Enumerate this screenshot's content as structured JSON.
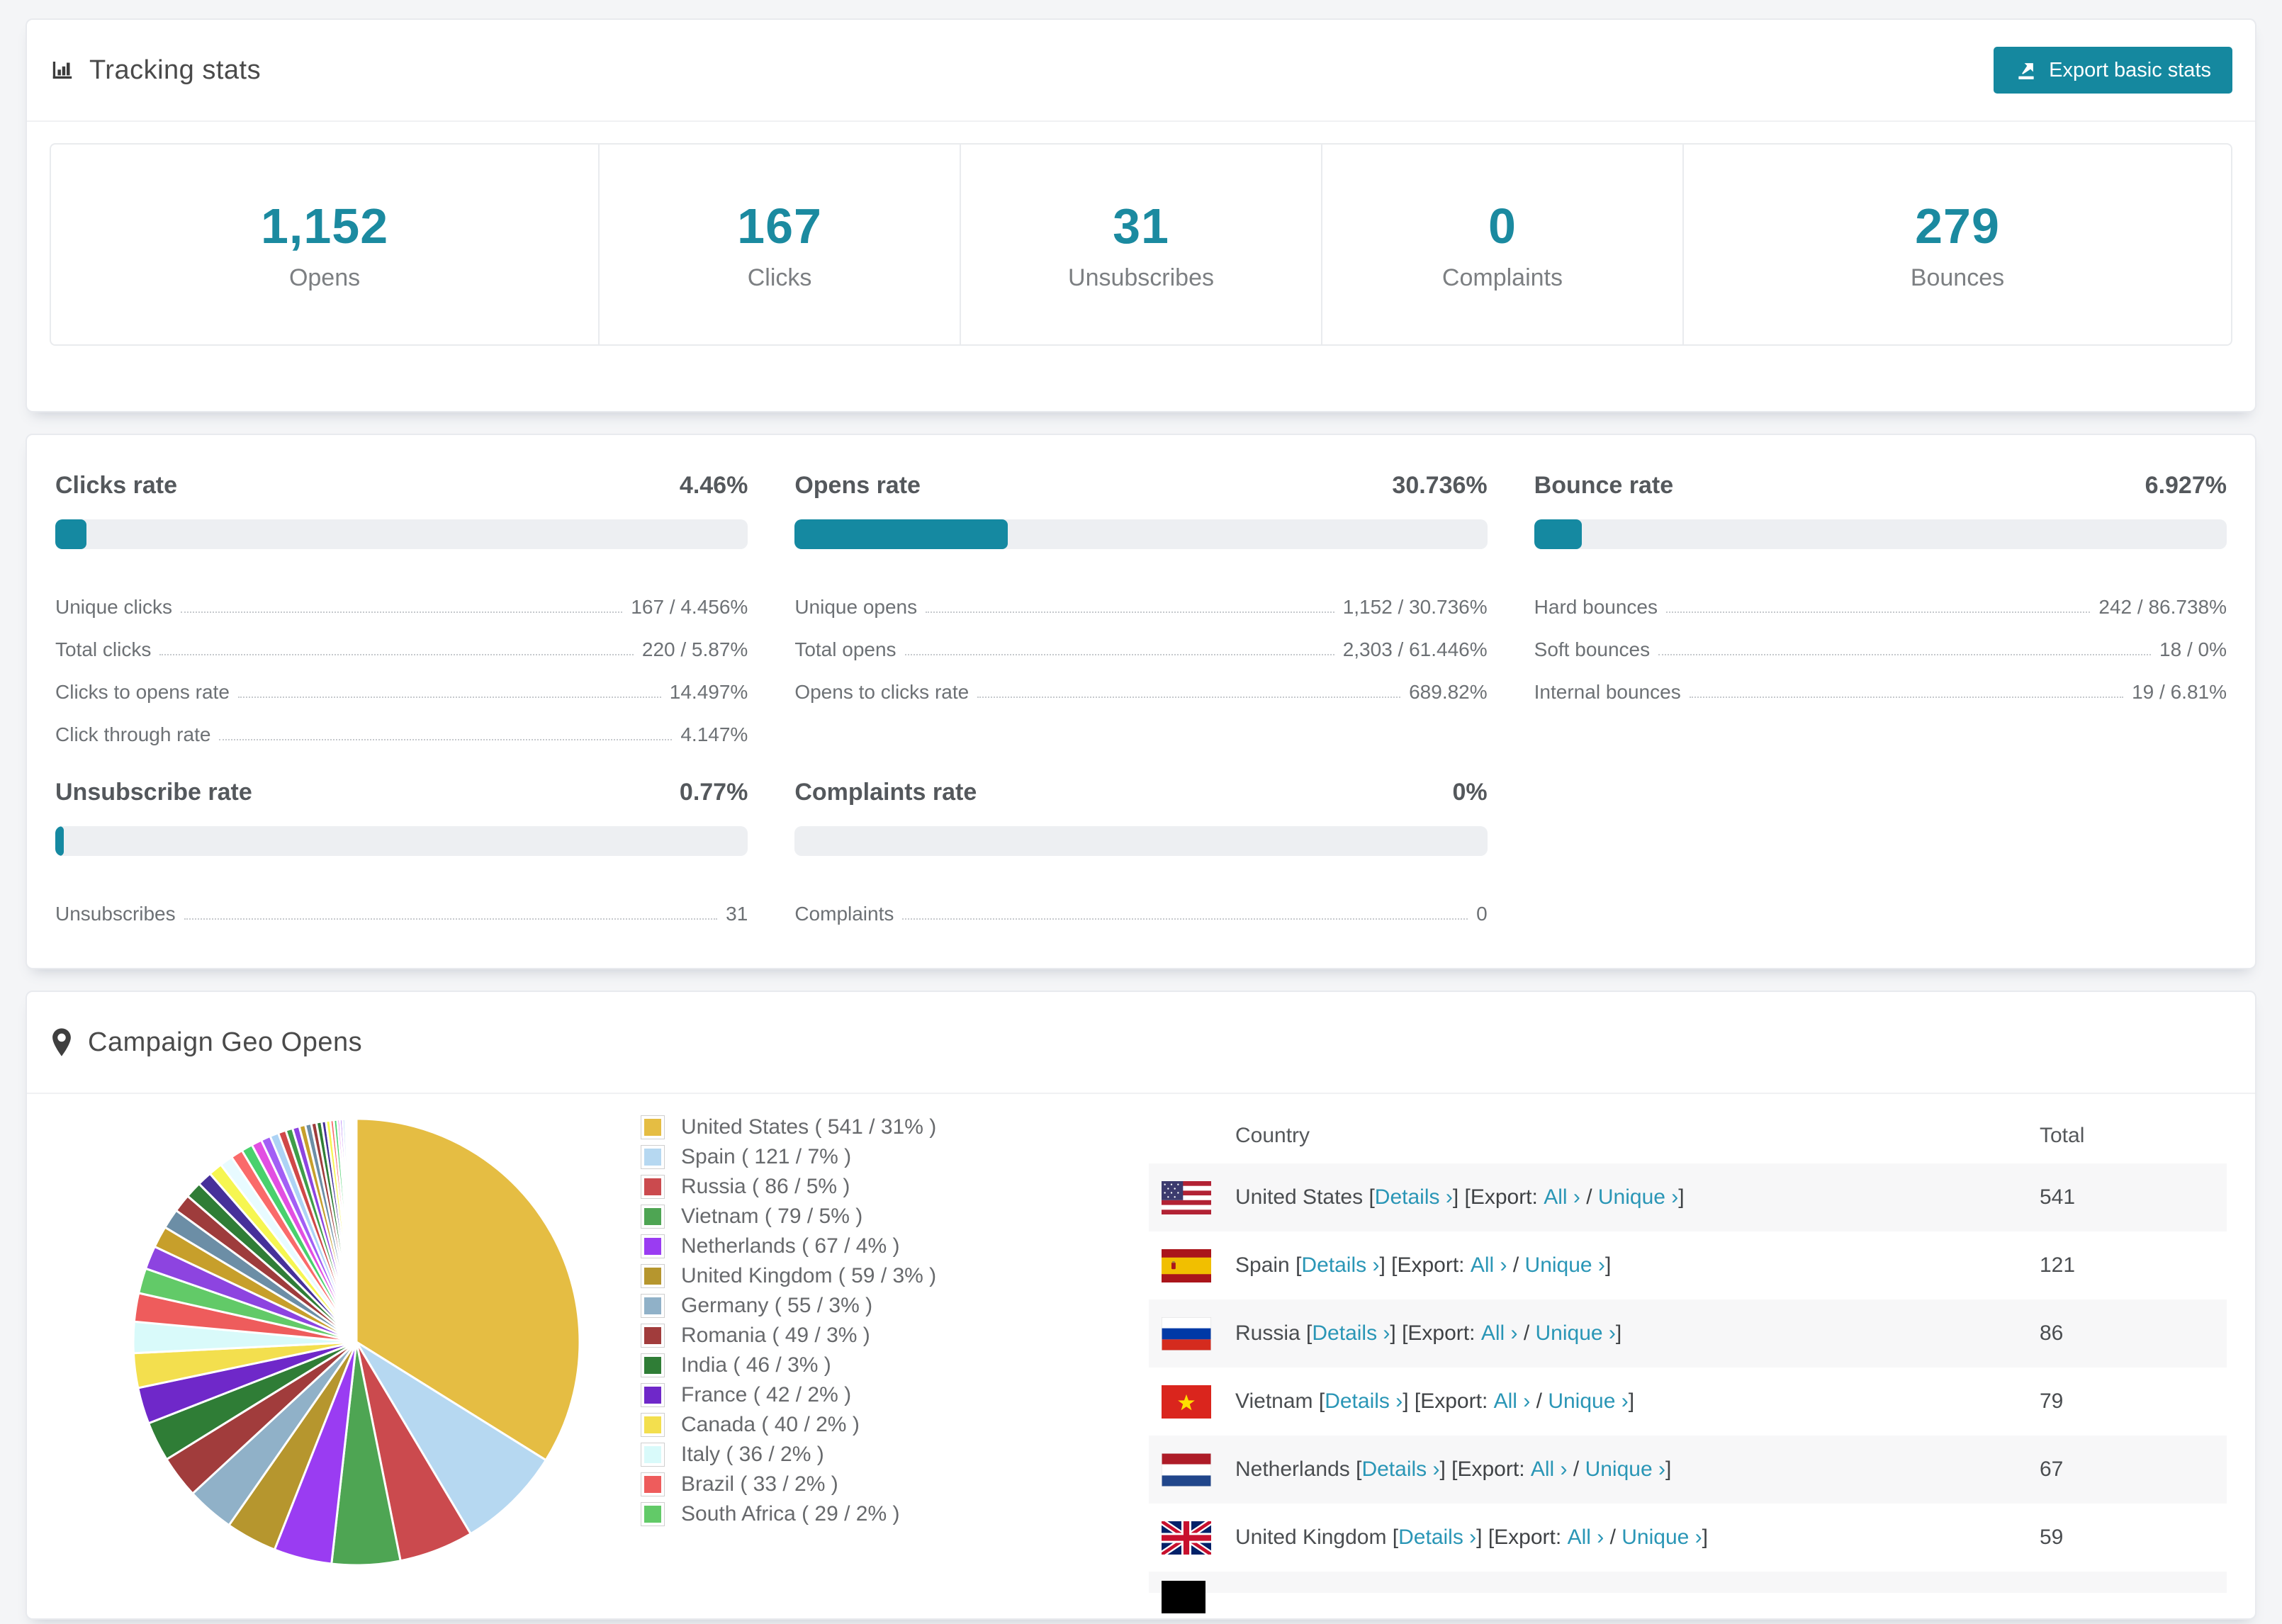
{
  "accent_color": "#1589a1",
  "link_color": "#2a96b6",
  "header": {
    "title": "Tracking stats",
    "export_button": "Export basic stats"
  },
  "summary": {
    "stats": [
      {
        "value": "1,152",
        "label": "Opens"
      },
      {
        "value": "167",
        "label": "Clicks"
      },
      {
        "value": "31",
        "label": "Unsubscribes"
      },
      {
        "value": "0",
        "label": "Complaints"
      },
      {
        "value": "279",
        "label": "Bounces"
      }
    ]
  },
  "rates": {
    "blocks": [
      {
        "id": "clicks-rate",
        "title": "Clicks rate",
        "value": "4.46%",
        "fill_pct": 4.46,
        "rows": [
          [
            "Unique clicks",
            "167 / 4.456%"
          ],
          [
            "Total clicks",
            "220 / 5.87%"
          ],
          [
            "Clicks to opens rate",
            "14.497%"
          ],
          [
            "Click through rate",
            "4.147%"
          ]
        ]
      },
      {
        "id": "opens-rate",
        "title": "Opens rate",
        "value": "30.736%",
        "fill_pct": 30.736,
        "rows": [
          [
            "Unique opens",
            "1,152 / 30.736%"
          ],
          [
            "Total opens",
            "2,303 / 61.446%"
          ],
          [
            "Opens to clicks rate",
            "689.82%"
          ]
        ]
      },
      {
        "id": "bounce-rate",
        "title": "Bounce rate",
        "value": "6.927%",
        "fill_pct": 6.927,
        "rows": [
          [
            "Hard bounces",
            "242 / 86.738%"
          ],
          [
            "Soft bounces",
            "18 / 0%"
          ],
          [
            "Internal bounces",
            "19 / 6.81%"
          ]
        ]
      },
      {
        "id": "unsubscribe-rate",
        "title": "Unsubscribe rate",
        "value": "0.77%",
        "fill_pct": 0.77,
        "rows": [
          [
            "Unsubscribes",
            "31"
          ]
        ]
      },
      {
        "id": "complaints-rate",
        "title": "Complaints rate",
        "value": "0%",
        "fill_pct": 0,
        "rows": [
          [
            "Complaints",
            "0"
          ]
        ]
      }
    ]
  },
  "geo": {
    "title": "Campaign Geo Opens",
    "table": {
      "headers": [
        "Country",
        "Total"
      ],
      "link_labels": {
        "details": "Details",
        "export": "Export:",
        "all": "All",
        "unique": "Unique",
        "arrow": "›"
      },
      "rows": [
        {
          "flag": "us",
          "country": "United States",
          "total": "541",
          "shaded": true
        },
        {
          "flag": "es",
          "country": "Spain",
          "total": "121",
          "shaded": false
        },
        {
          "flag": "ru",
          "country": "Russia",
          "total": "86",
          "shaded": true
        },
        {
          "flag": "vn",
          "country": "Vietnam",
          "total": "79",
          "shaded": false
        },
        {
          "flag": "nl",
          "country": "Netherlands",
          "total": "67",
          "shaded": true
        },
        {
          "flag": "gb",
          "country": "United Kingdom",
          "total": "59",
          "shaded": false
        },
        {
          "flag": "partial",
          "country": "",
          "total": "",
          "shaded": true,
          "partial": true
        }
      ]
    }
  },
  "chart_data": {
    "type": "pie",
    "title": "Campaign Geo Opens",
    "legend_position": "right",
    "start_angle_deg": 0,
    "direction": "clockwise",
    "slices": [
      {
        "label": "United States",
        "value": 541,
        "pct": "31%",
        "color": "#e5bd43"
      },
      {
        "label": "Spain",
        "value": 121,
        "pct": "7%",
        "color": "#b6d8f1"
      },
      {
        "label": "Russia",
        "value": 86,
        "pct": "5%",
        "color": "#cb4a4e"
      },
      {
        "label": "Vietnam",
        "value": 79,
        "pct": "5%",
        "color": "#4ea553"
      },
      {
        "label": "Netherlands",
        "value": 67,
        "pct": "4%",
        "color": "#9a3cf2"
      },
      {
        "label": "United Kingdom",
        "value": 59,
        "pct": "3%",
        "color": "#b6962e"
      },
      {
        "label": "Germany",
        "value": 55,
        "pct": "3%",
        "color": "#90b1c8"
      },
      {
        "label": "Romania",
        "value": 49,
        "pct": "3%",
        "color": "#a13c3c"
      },
      {
        "label": "India",
        "value": 46,
        "pct": "3%",
        "color": "#2f7d36"
      },
      {
        "label": "France",
        "value": 42,
        "pct": "2%",
        "color": "#6f28c9"
      },
      {
        "label": "Canada",
        "value": 40,
        "pct": "2%",
        "color": "#f3df4e"
      },
      {
        "label": "Italy",
        "value": 36,
        "pct": "2%",
        "color": "#d9fafa"
      },
      {
        "label": "Brazil",
        "value": 33,
        "pct": "2%",
        "color": "#ee5c5c"
      },
      {
        "label": "South Africa",
        "value": 29,
        "pct": "2%",
        "color": "#62ca68"
      }
    ],
    "other_slices": [
      {
        "value": 27,
        "color": "#8d44e0"
      },
      {
        "value": 25,
        "color": "#c79f2b"
      },
      {
        "value": 23,
        "color": "#6c8ea6"
      },
      {
        "value": 21,
        "color": "#9e3c3c"
      },
      {
        "value": 19,
        "color": "#2f7d36"
      },
      {
        "value": 17,
        "color": "#46309a"
      },
      {
        "value": 16,
        "color": "#f6f651"
      },
      {
        "value": 15,
        "color": "#e8fbff"
      },
      {
        "value": 14,
        "color": "#fa6a6a"
      },
      {
        "value": 13,
        "color": "#49d16d"
      },
      {
        "value": 12,
        "color": "#e24fe2"
      },
      {
        "value": 11,
        "color": "#a25ff5"
      },
      {
        "value": 10,
        "color": "#add3f5"
      },
      {
        "value": 9,
        "color": "#d04848"
      },
      {
        "value": 8,
        "color": "#3f9d49"
      },
      {
        "value": 8,
        "color": "#8d44e0"
      },
      {
        "value": 7,
        "color": "#c79f2b"
      },
      {
        "value": 7,
        "color": "#6c8ea6"
      },
      {
        "value": 6,
        "color": "#9e3c3c"
      },
      {
        "value": 6,
        "color": "#2f7d36"
      },
      {
        "value": 5,
        "color": "#46309a"
      },
      {
        "value": 5,
        "color": "#f6f651"
      },
      {
        "value": 4,
        "color": "#fa6a6a"
      },
      {
        "value": 4,
        "color": "#49d16d"
      },
      {
        "value": 3,
        "color": "#e24fe2"
      },
      {
        "value": 3,
        "color": "#a25ff5"
      },
      {
        "value": 3,
        "color": "#add3f5"
      },
      {
        "value": 2,
        "color": "#d04848"
      },
      {
        "value": 2,
        "color": "#3f9d49"
      },
      {
        "value": 2,
        "color": "#ff6fb0"
      },
      {
        "value": 2,
        "color": "#5bc0de"
      },
      {
        "value": 1,
        "color": "#b8860b"
      },
      {
        "value": 1,
        "color": "#7b68ee"
      },
      {
        "value": 1,
        "color": "#dc5c5c"
      },
      {
        "value": 1,
        "color": "#66cdaa"
      },
      {
        "value": 1,
        "color": "#da70d6"
      }
    ]
  }
}
